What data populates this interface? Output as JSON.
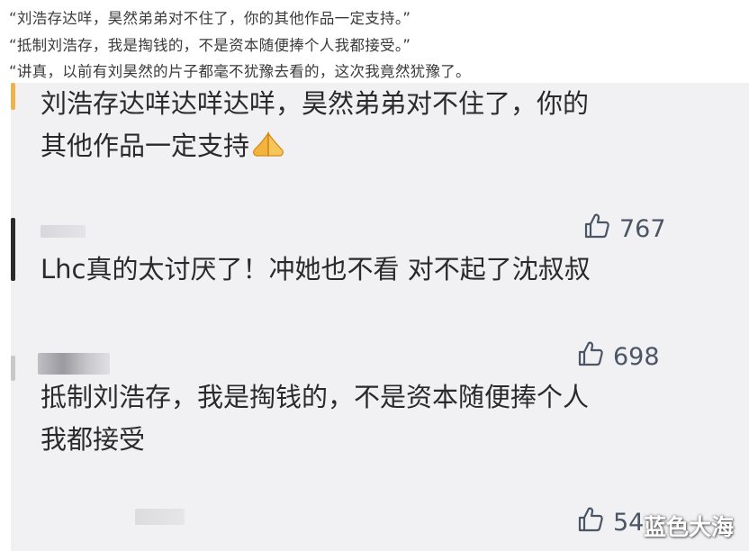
{
  "quotes": [
    "“刘浩存达咩，昊然弟弟对不住了，你的其他作品一定支持。”",
    "“抵制刘浩存，我是掏钱的，不是资本随便捧个人我都接受。”",
    "“讲真，以前有刘昊然的片子都毫不犹豫去看的，这次我竟然犹豫了。"
  ],
  "comments": [
    {
      "text_line1": "刘浩存达咩达咩达咩，昊然弟弟对不住了，你的",
      "text_line2": "其他作品一定支持",
      "emoji_icon": "praying-hands-icon"
    },
    {
      "text_line1": "Lhc真的太讨厌了！冲她也不看 对不起了沈叔叔"
    },
    {
      "text_line1": "抵制刘浩存，我是掏钱的，不是资本随便捧个人",
      "text_line2": "我都接受"
    }
  ],
  "likes": [
    "767",
    "698",
    "54"
  ],
  "watermark": "蓝色大海",
  "colors": {
    "panel_bg": "#f1f1f3",
    "text": "#2a2a2a",
    "like": "#4a5566"
  }
}
